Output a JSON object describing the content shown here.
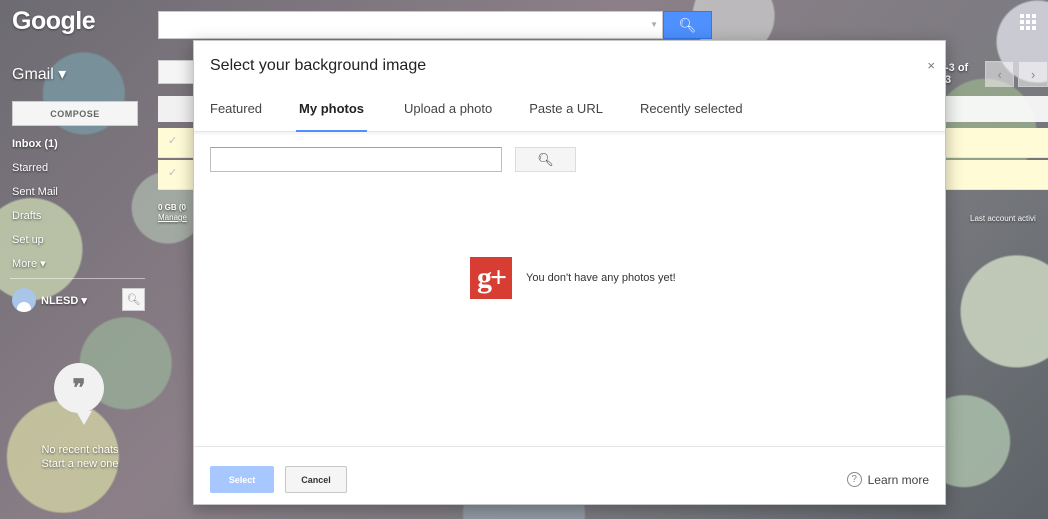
{
  "app": {
    "logo": "Google",
    "label": "Gmail ▾"
  },
  "sidebar": {
    "compose_label": "COMPOSE",
    "items": [
      {
        "label": "Inbox (1)",
        "bold": true
      },
      {
        "label": "Starred"
      },
      {
        "label": "Sent Mail"
      },
      {
        "label": "Drafts"
      },
      {
        "label": "Set up"
      },
      {
        "label": "More ▾"
      }
    ],
    "account_name": "NLESD ▾",
    "chat_empty_line1": "No recent chats",
    "chat_empty_line2": "Start a new one"
  },
  "storage": {
    "usage": "0 GB (0",
    "manage": "Manage"
  },
  "pager": {
    "count": "-3 of 3",
    "prev": "‹",
    "next": "›"
  },
  "last_activity": "Last account activi",
  "dialog": {
    "title": "Select your background image",
    "close": "×",
    "tabs": [
      {
        "label": "Featured"
      },
      {
        "label": "My photos",
        "active": true
      },
      {
        "label": "Upload a photo"
      },
      {
        "label": "Paste a URL"
      },
      {
        "label": "Recently selected"
      }
    ],
    "search_placeholder": "",
    "empty_message": "You don't have any photos yet!",
    "gplus_logo": "g+",
    "select_label": "Select",
    "cancel_label": "Cancel",
    "learn_more_label": "Learn more",
    "help_icon": "?"
  },
  "colors": {
    "accent": "#4d90fe",
    "select_disabled": "#a6c8ff",
    "gplus_red": "#d73d32"
  }
}
